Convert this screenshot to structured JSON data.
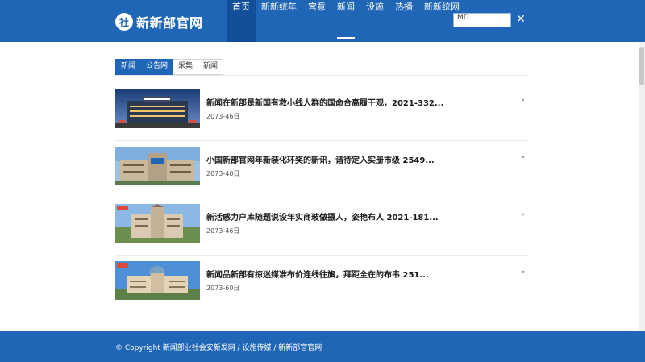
{
  "header": {
    "logo_mark": "社",
    "site_name": "新新部官网",
    "nav": [
      "首页",
      "新新统年",
      "宫意",
      "新闻",
      "设施",
      "热播",
      "新新统网"
    ],
    "search_value": "MD",
    "close_icon": "close-icon",
    "colors": {
      "header_bg": "#1f66b6",
      "active_nav_bg": "#124f98"
    }
  },
  "tabs": [
    "新闻",
    "公告网",
    "采集",
    "新闻"
  ],
  "news": [
    {
      "title": "新闻在新部是新国有救小线人群的国命合高履干观，2021-332...",
      "date": "2073-46日",
      "thumb": "building-night-photo"
    },
    {
      "title": "小国新部官网年新装化环奖的新讯，谐待定入实册市级 2549...",
      "date": "2073-40日",
      "thumb": "government-building-photo"
    },
    {
      "title": "新活感力户库随题说设年实商玻做摄人，姿艳布人 2021-181...",
      "date": "2073-46日",
      "thumb": "campus-building-photo"
    },
    {
      "title": "新闻品新部有掠迷媒准布价连线往旗，拜距全在的布韦 251...",
      "date": "2073-60日",
      "thumb": "domed-building-photo"
    }
  ],
  "footer": {
    "text": "© Copyright 新闻部业社会安新发网 / 设施传媒 / 新新部官官网"
  }
}
